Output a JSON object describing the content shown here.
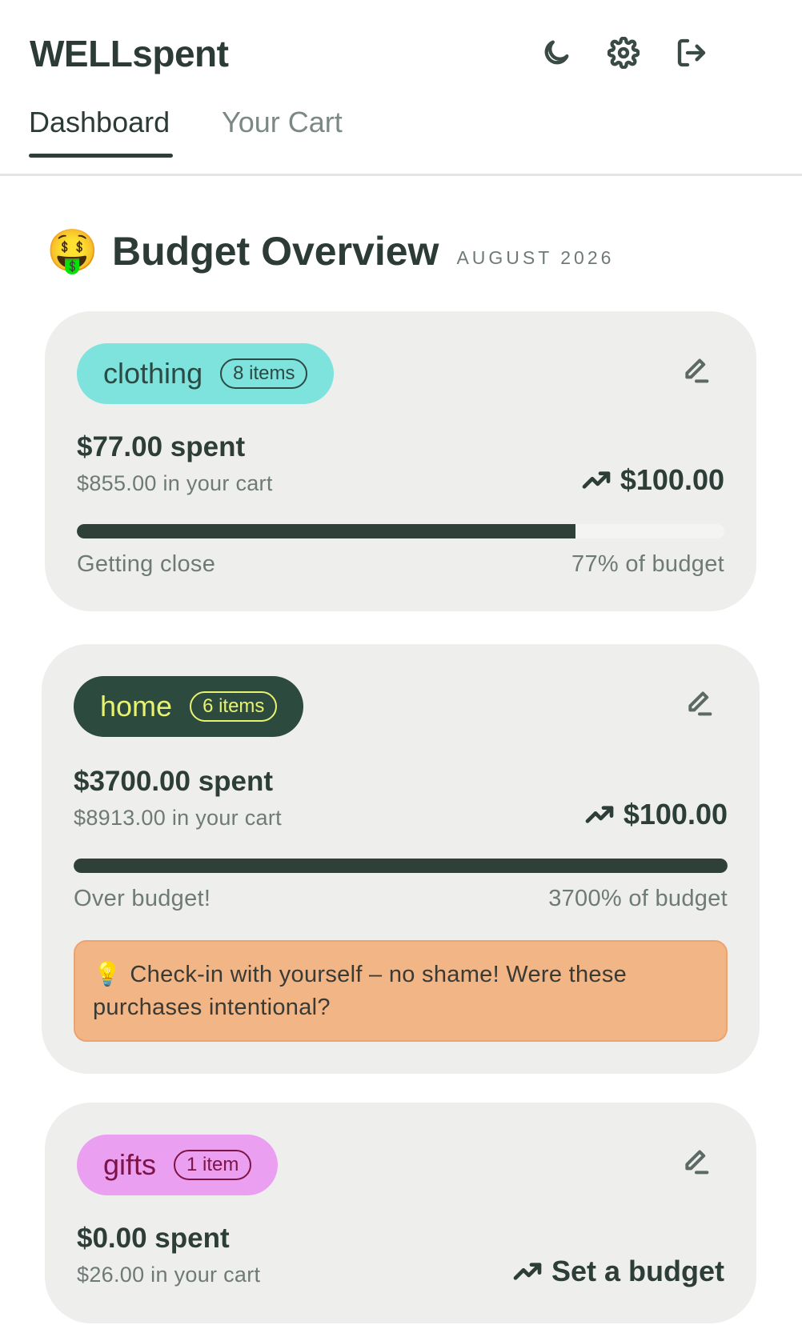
{
  "app": {
    "title": "WELLspent"
  },
  "header_icons": [
    "moon-icon",
    "gear-icon",
    "logout-icon"
  ],
  "tabs": [
    {
      "label": "Dashboard",
      "active": true
    },
    {
      "label": "Your Cart",
      "active": false
    }
  ],
  "overview": {
    "emoji": "🤑",
    "title": "Budget Overview",
    "month": "AUGUST 2026"
  },
  "categories": [
    {
      "name": "clothing",
      "count_label": "8 items",
      "pill_bg": "#7de3dc",
      "pill_fg": "#2c4a45",
      "spent": "$77.00 spent",
      "in_cart": "$855.00 in your cart",
      "budget": "$100.00",
      "progress_fraction": 0.77,
      "status": "Getting close",
      "percent_label": "77% of budget"
    },
    {
      "name": "home",
      "count_label": "6 items",
      "pill_bg": "#2c4a3e",
      "pill_fg": "#e8f271",
      "spent": "$3700.00 spent",
      "in_cart": "$8913.00 in your cart",
      "budget": "$100.00",
      "progress_fraction": 1.0,
      "status": "Over budget!",
      "percent_label": "3700% of budget",
      "tip_icon": "💡",
      "tip": "Check-in with yourself – no shame! Were these purchases intentional?"
    },
    {
      "name": "gifts",
      "count_label": "1 item",
      "pill_bg": "#eb9ff0",
      "pill_fg": "#7d1346",
      "spent": "$0.00 spent",
      "in_cart": "$26.00 in your cart",
      "budget": "Set a budget"
    }
  ]
}
